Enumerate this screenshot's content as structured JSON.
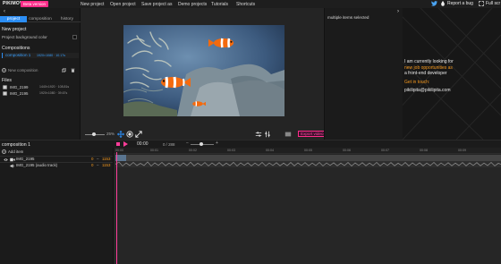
{
  "topbar": {
    "logo": "PIKIMOV",
    "beta": "Beta version",
    "menu": [
      "New project",
      "Open project",
      "Save project as",
      "Demo projects",
      "Tutorials",
      "Shortcuts"
    ],
    "report_bug": "Report a bug",
    "full_screen": "Full scr"
  },
  "left": {
    "back": "‹",
    "tabs": [
      "project",
      "composition",
      "history"
    ],
    "new_project": "New project",
    "bg_color_label": "Project background color",
    "compositions_title": "Compositions",
    "composition_name": "composition 1",
    "composition_meta": "1920×1080 · 10.17s",
    "new_composition": "New composition",
    "files_title": "Files",
    "files": [
      {
        "name": "IMG_2199",
        "meta": "1440×1920 · 108.81s"
      },
      {
        "name": "IMG_2195",
        "meta": "1920×1080 · 39.67s"
      }
    ]
  },
  "preview": {
    "zoom": "25%",
    "export": "Export video"
  },
  "props": {
    "label": "multiple items selected",
    "arrow": "›"
  },
  "promo": {
    "line1": "I am currently looking for",
    "line2": "new job opportunities as",
    "line3": "a front-end developer",
    "line4": "Get in touch:",
    "line5": "pikilipita@pikilipita.com"
  },
  "timeline": {
    "name": "composition 1",
    "add_item": "Add item",
    "timecode": "00:00",
    "frames": "0 / 288",
    "zoom_minus": "−",
    "zoom_plus": "+",
    "ticks": [
      "00:00",
      "00:01",
      "00:02",
      "00:03",
      "00:04",
      "00:05",
      "00:06",
      "00:07",
      "00:08",
      "00:09"
    ],
    "tracks": [
      {
        "name": "IMG_2195",
        "start": "0",
        "end": "1153"
      },
      {
        "name": "IMG_2195 (audio track)",
        "start": "0",
        "end": "1153"
      }
    ]
  },
  "colors": {
    "accent_pink": "#ff2d8a",
    "accent_blue": "#2c8ef5",
    "accent_orange": "#f79a1e"
  }
}
